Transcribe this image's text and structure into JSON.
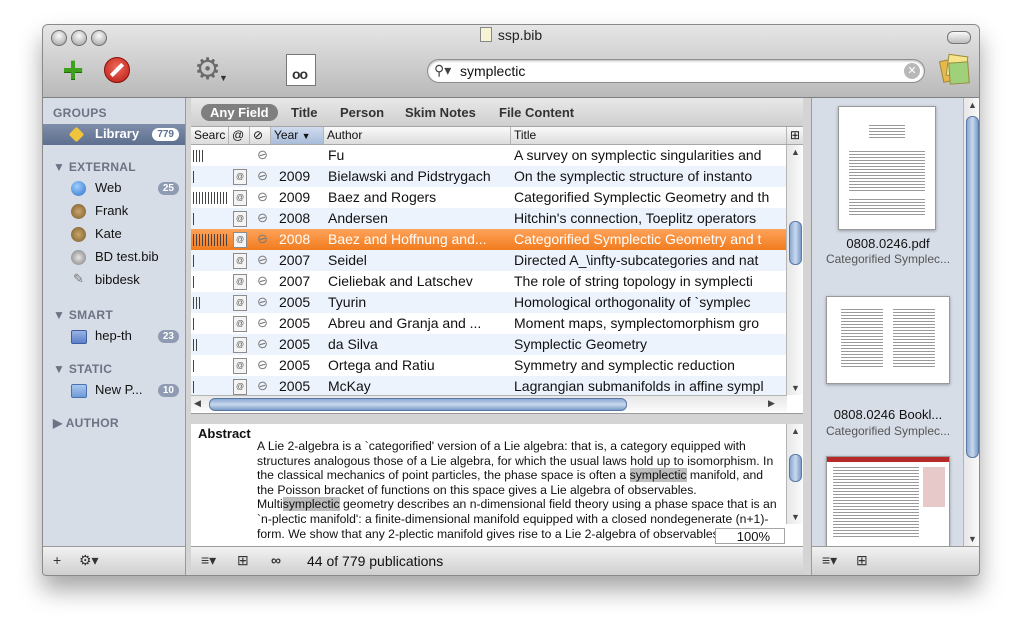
{
  "window": {
    "title": "ssp.bib"
  },
  "search": {
    "value": "symplectic"
  },
  "scope_bar": [
    "Any Field",
    "Title",
    "Person",
    "Skim Notes",
    "File Content"
  ],
  "sidebar": {
    "groups_header": "GROUPS",
    "library": {
      "label": "Library",
      "count": "779"
    },
    "external_header": "EXTERNAL",
    "external_items": [
      {
        "label": "Web",
        "count": "25"
      },
      {
        "label": "Frank",
        "count": ""
      },
      {
        "label": "Kate",
        "count": ""
      },
      {
        "label": "BD test.bib",
        "count": ""
      },
      {
        "label": "bibdesk",
        "count": ""
      }
    ],
    "smart_header": "SMART",
    "smart_items": [
      {
        "label": "hep-th",
        "count": "23"
      }
    ],
    "static_header": "STATIC",
    "static_items": [
      {
        "label": "New P...",
        "count": "10"
      }
    ],
    "author_header": "AUTHOR"
  },
  "table": {
    "columns": [
      "Searc",
      "@",
      "",
      "Year",
      "Author",
      "Title"
    ],
    "rows": [
      {
        "year": "",
        "author": "Fu",
        "title": "A survey on symplectic singularities and",
        "rel": 12
      },
      {
        "year": "2009",
        "author": "Bielawski and Pidstrygach",
        "title": "On the symplectic structure of instanto",
        "rel": 2
      },
      {
        "year": "2009",
        "author": "Baez and Rogers",
        "title": "Categorified Symplectic Geometry and th",
        "rel": 36
      },
      {
        "year": "2008",
        "author": "Andersen",
        "title": "Hitchin's connection, Toeplitz operators",
        "rel": 2
      },
      {
        "year": "2008",
        "author": "Baez and Hoffnung and...",
        "title": "Categorified Symplectic Geometry and t",
        "rel": 36
      },
      {
        "year": "2007",
        "author": "Seidel",
        "title": "Directed A_\\infty-subcategories and nat",
        "rel": 2
      },
      {
        "year": "2007",
        "author": "Cieliebak and Latschev",
        "title": "The role of string topology in symplecti",
        "rel": 2
      },
      {
        "year": "2005",
        "author": "Tyurin",
        "title": "Homological orthogonality of `symplec",
        "rel": 8
      },
      {
        "year": "2005",
        "author": "Abreu and Granja and ...",
        "title": "Moment maps, symplectomorphism gro",
        "rel": 2
      },
      {
        "year": "2005",
        "author": "da Silva",
        "title": "Symplectic Geometry",
        "rel": 4
      },
      {
        "year": "2005",
        "author": "Ortega and Ratiu",
        "title": "Symmetry and symplectic reduction",
        "rel": 2
      },
      {
        "year": "2005",
        "author": "McKay",
        "title": "Lagrangian submanifolds in affine sympl",
        "rel": 2
      }
    ],
    "selected_index": 4
  },
  "abstract": {
    "label": "Abstract",
    "parts": [
      "A Lie 2-algebra is a `categorified' version of a Lie algebra: that is, a category equipped with structures analogous those of a Lie algebra, for which the usual laws hold up to isomorphism. In the classical mechanics of point particles, the phase space is often a ",
      "symplectic",
      " manifold, and the Poisson bracket of functions on this space gives a Lie algebra of observables. Multi",
      "symplectic",
      " geometry describes an n-dimensional field theory using a phase space that is an `n-plectic manifold': a finite-dimensional manifold equipped with a closed nondegenerate (n+1)-form. We show that any 2-plectic manifold gives rise to a Lie 2-algebra of observables."
    ],
    "zoom": "100%"
  },
  "status": "44 of 779 publications",
  "files": [
    {
      "name": "0808.0246.pdf",
      "subtitle": "Categorified Symplec..."
    },
    {
      "name": "0808.0246 Bookl...",
      "subtitle": "Categorified Symplec..."
    }
  ],
  "colors": {
    "selection": "#f17b1e",
    "sidebar_bg": "#d7dde7",
    "accent_green": "#3ea11b"
  },
  "icons": [
    "plus-icon",
    "stop-icon",
    "gear-icon",
    "preview-icon",
    "search-icon",
    "notes-icon"
  ]
}
